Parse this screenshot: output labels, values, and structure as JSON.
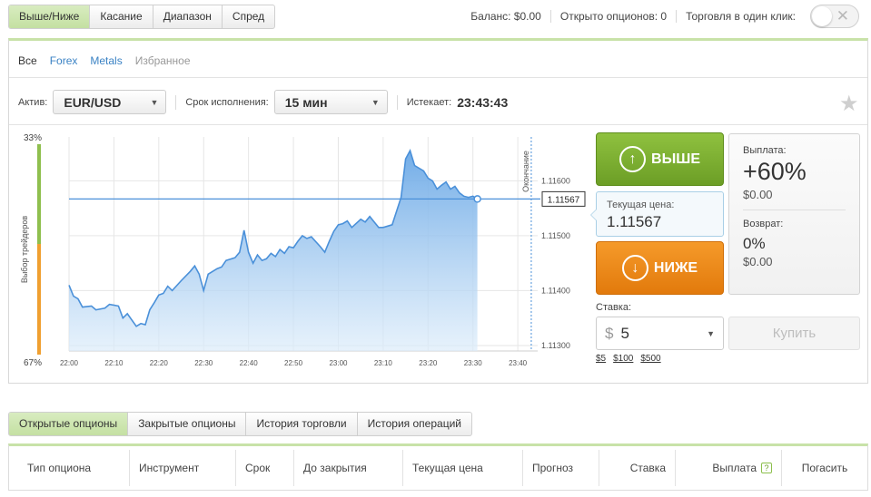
{
  "mode_tabs": [
    {
      "label": "Выше/Ниже",
      "active": true
    },
    {
      "label": "Касание",
      "active": false
    },
    {
      "label": "Диапазон",
      "active": false
    },
    {
      "label": "Спред",
      "active": false
    }
  ],
  "top_info": {
    "balance_label": "Баланс:",
    "balance_value": "$0.00",
    "open_options_label": "Открыто опционов:",
    "open_options_value": "0",
    "one_click_label": "Торговля в один клик:",
    "toggle_icon": "close-x-icon"
  },
  "category_tabs": [
    {
      "label": "Все",
      "style": "all"
    },
    {
      "label": "Forex",
      "style": "link"
    },
    {
      "label": "Metals",
      "style": "link"
    },
    {
      "label": "Избранное",
      "style": "fav"
    }
  ],
  "asset": {
    "label": "Актив:",
    "value": "EUR/USD"
  },
  "expiry": {
    "label": "Срок исполнения:",
    "value": "15 мин"
  },
  "expires": {
    "label": "Истекает:",
    "value": "23:43:43"
  },
  "chart_data": {
    "type": "area",
    "x_ticks": [
      "22:00",
      "22:10",
      "22:20",
      "22:30",
      "22:40",
      "22:50",
      "23:00",
      "23:10",
      "23:20",
      "23:30",
      "23:40"
    ],
    "x_ticks_minutes": [
      0,
      10,
      20,
      30,
      40,
      50,
      60,
      70,
      80,
      90,
      100
    ],
    "y_ticks": [
      "1.11300",
      "1.11400",
      "1.11500",
      "1.11600"
    ],
    "y_tick_values": [
      1.113,
      1.114,
      1.115,
      1.116
    ],
    "ylim": [
      1.1129,
      1.1168
    ],
    "xlim": [
      0,
      102
    ],
    "current_price_label": "1.11567",
    "current_price": 1.11567,
    "expiry_line_label": "Окончание",
    "expiry_minute": 103,
    "sentiment": {
      "label": "Выбор трейдеров",
      "top": "33%",
      "bottom": "67%",
      "top_color": "#8fbf4e",
      "bottom_color": "#f0a030"
    },
    "series": [
      {
        "points": [
          [
            0,
            1.1141
          ],
          [
            1,
            1.1139
          ],
          [
            2,
            1.11385
          ],
          [
            3,
            1.1137
          ],
          [
            5,
            1.11372
          ],
          [
            6,
            1.11365
          ],
          [
            8,
            1.11368
          ],
          [
            9,
            1.11375
          ],
          [
            11,
            1.11372
          ],
          [
            12,
            1.1135
          ],
          [
            13,
            1.11358
          ],
          [
            15,
            1.11335
          ],
          [
            16,
            1.1134
          ],
          [
            17,
            1.11338
          ],
          [
            18,
            1.11365
          ],
          [
            19,
            1.11378
          ],
          [
            20,
            1.11392
          ],
          [
            21,
            1.11395
          ],
          [
            22,
            1.11408
          ],
          [
            23,
            1.114
          ],
          [
            25,
            1.11418
          ],
          [
            27,
            1.11435
          ],
          [
            28,
            1.11445
          ],
          [
            29,
            1.1143
          ],
          [
            30,
            1.114
          ],
          [
            31,
            1.1143
          ],
          [
            33,
            1.1144
          ],
          [
            34,
            1.11443
          ],
          [
            35,
            1.11455
          ],
          [
            37,
            1.1146
          ],
          [
            38,
            1.1147
          ],
          [
            39,
            1.1151
          ],
          [
            40,
            1.1147
          ],
          [
            41,
            1.1145
          ],
          [
            42,
            1.11465
          ],
          [
            43,
            1.11455
          ],
          [
            44,
            1.11458
          ],
          [
            45,
            1.11468
          ],
          [
            46,
            1.11462
          ],
          [
            47,
            1.11475
          ],
          [
            48,
            1.11468
          ],
          [
            49,
            1.1148
          ],
          [
            50,
            1.11478
          ],
          [
            51,
            1.1149
          ],
          [
            52,
            1.115
          ],
          [
            53,
            1.11495
          ],
          [
            54,
            1.11498
          ],
          [
            56,
            1.1148
          ],
          [
            57,
            1.1147
          ],
          [
            58,
            1.1149
          ],
          [
            59,
            1.11508
          ],
          [
            60,
            1.1152
          ],
          [
            61,
            1.11522
          ],
          [
            62,
            1.11527
          ],
          [
            63,
            1.11515
          ],
          [
            65,
            1.1153
          ],
          [
            66,
            1.11525
          ],
          [
            67,
            1.11535
          ],
          [
            68,
            1.11525
          ],
          [
            69,
            1.11515
          ],
          [
            70,
            1.11515
          ],
          [
            72,
            1.1152
          ],
          [
            73,
            1.11545
          ],
          [
            74,
            1.1157
          ],
          [
            75,
            1.1164
          ],
          [
            76,
            1.11655
          ],
          [
            77,
            1.11628
          ],
          [
            79,
            1.11618
          ],
          [
            80,
            1.11605
          ],
          [
            81,
            1.116
          ],
          [
            82,
            1.11585
          ],
          [
            83,
            1.11592
          ],
          [
            84,
            1.11598
          ],
          [
            85,
            1.11585
          ],
          [
            86,
            1.1159
          ],
          [
            87,
            1.11578
          ],
          [
            88,
            1.11572
          ],
          [
            89,
            1.1157
          ],
          [
            90,
            1.11572
          ],
          [
            91,
            1.11567
          ]
        ]
      }
    ]
  },
  "up_button": {
    "label": "ВЫШЕ",
    "icon": "arrow-up-circle-icon"
  },
  "down_button": {
    "label": "НИЖЕ",
    "icon": "arrow-down-circle-icon"
  },
  "current_price_box": {
    "label": "Текущая цена:",
    "value": "1.11567"
  },
  "payout": {
    "label": "Выплата:",
    "percent": "+60%",
    "amount": "$0.00",
    "refund_label": "Возврат:",
    "refund_percent": "0%",
    "refund_amount": "$0.00"
  },
  "stake": {
    "label": "Ставка:",
    "currency": "$",
    "value": "5",
    "quick": [
      "$5",
      "$100",
      "$500"
    ]
  },
  "buy_button": {
    "label": "Купить"
  },
  "bottom_tabs": [
    {
      "label": "Открытые опционы",
      "active": true
    },
    {
      "label": "Закрытые опционы",
      "active": false
    },
    {
      "label": "История торговли",
      "active": false
    },
    {
      "label": "История операций",
      "active": false
    }
  ],
  "table_columns": [
    "Тип опциона",
    "Инструмент",
    "Срок",
    "До закрытия",
    "Текущая цена",
    "Прогноз",
    "Ставка",
    "Выплата",
    "Погасить"
  ],
  "accent_green": "#8fc13f",
  "accent_orange": "#f0901e",
  "chart_line_color": "#4a90d9"
}
